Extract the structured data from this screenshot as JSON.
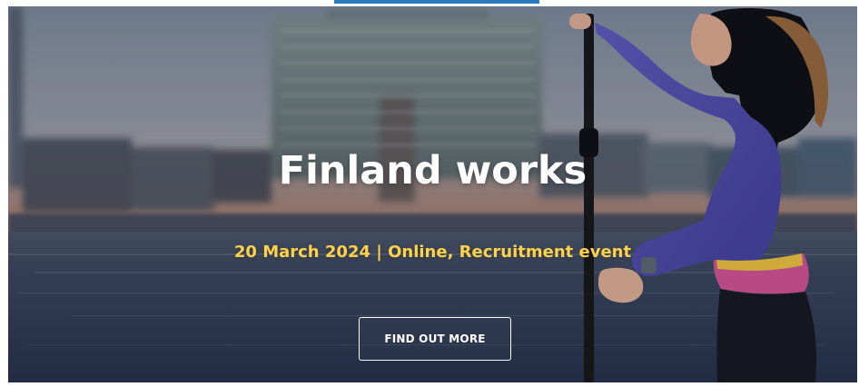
{
  "hero": {
    "title": "Finland works",
    "subtitle": "20 March 2024 | Online, Recruitment event",
    "button_label": "FIND OUT MORE"
  },
  "colors": {
    "accent_indicator": "#2c79bd",
    "title": "#ffffff",
    "subtitle": "#ffd24a",
    "button_border": "#ffffff"
  },
  "icons": {
    "background_image": "paddleboarder-city-waterfront-image"
  }
}
